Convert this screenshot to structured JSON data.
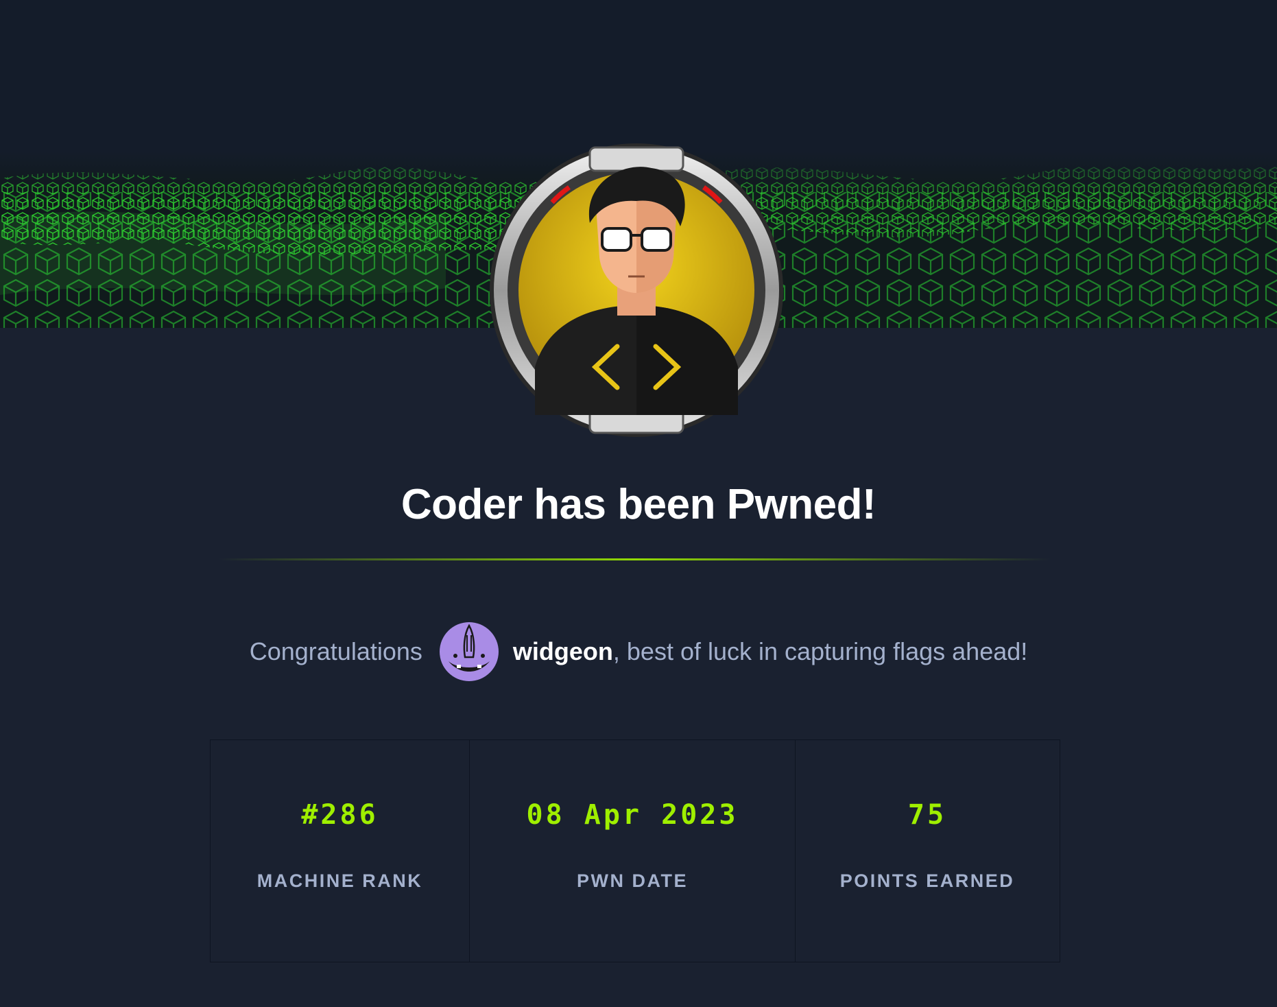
{
  "machine": {
    "name": "Coder",
    "title": "Coder has been Pwned!"
  },
  "congrats": {
    "prefix": "Congratulations",
    "username": "widgeon",
    "suffix": ", best of luck in capturing flags ahead!"
  },
  "stats": [
    {
      "value": "#286",
      "label": "MACHINE RANK"
    },
    {
      "value": "08 Apr 2023",
      "label": "PWN DATE"
    },
    {
      "value": "75",
      "label": "POINTS EARNED"
    }
  ],
  "colors": {
    "background": "#1a2130",
    "accent": "#9fef00",
    "muted_text": "#a4b1cd",
    "badge_yellow": "#e8c417"
  },
  "icons": {
    "machine_avatar": "coder-machine-avatar",
    "user_avatar": "purple-creature-avatar"
  }
}
